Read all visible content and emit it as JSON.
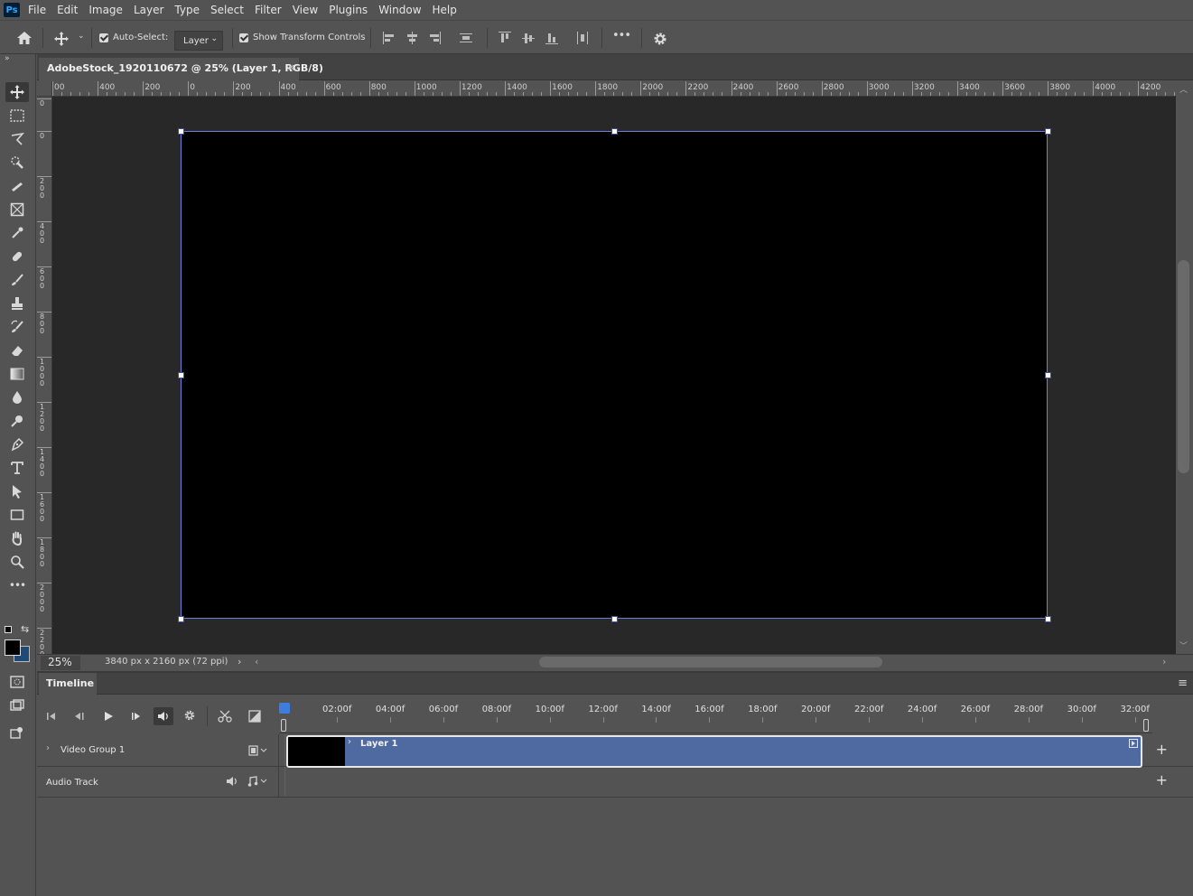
{
  "menubar": {
    "logo": "Ps",
    "items": [
      "File",
      "Edit",
      "Image",
      "Layer",
      "Type",
      "Select",
      "Filter",
      "View",
      "Plugins",
      "Window",
      "Help"
    ]
  },
  "options": {
    "auto_select_label": "Auto-Select:",
    "auto_select_target": "Layer",
    "show_transform_label": "Show Transform Controls",
    "more_label": "•••"
  },
  "document": {
    "tab_title": "AdobeStock_1920110672 @ 25% (Layer 1, RGB/8)",
    "close_glyph": "×"
  },
  "ruler": {
    "top_labels": [
      "00",
      "400",
      "200",
      "0",
      "200",
      "400",
      "600",
      "800",
      "1000",
      "1200",
      "1400",
      "1600",
      "1800",
      "2000",
      "2200",
      "2400",
      "2600",
      "2800",
      "3000",
      "3200",
      "3400",
      "3600",
      "3800",
      "4000",
      "4200"
    ],
    "left_labels": [
      "0",
      "0",
      "200",
      "400",
      "600",
      "800",
      "1000",
      "1200",
      "1400",
      "1600",
      "1800",
      "2000",
      "2200"
    ]
  },
  "status": {
    "zoom": "25%",
    "doc_info": "3840 px x 2160 px (72 ppi)"
  },
  "timeline": {
    "tab_label": "Timeline",
    "time_labels": [
      "02:00f",
      "04:00f",
      "06:00f",
      "08:00f",
      "10:00f",
      "12:00f",
      "14:00f",
      "16:00f",
      "18:00f",
      "20:00f",
      "22:00f",
      "24:00f",
      "26:00f",
      "28:00f",
      "30:00f",
      "32:00f"
    ],
    "video_group_label": "Video Group 1",
    "clip_label": "Layer 1",
    "audio_track_label": "Audio Track"
  },
  "colors": {
    "accent": "#3d7de0",
    "clip": "#4f6aa0",
    "playhead": "#c0392b"
  }
}
